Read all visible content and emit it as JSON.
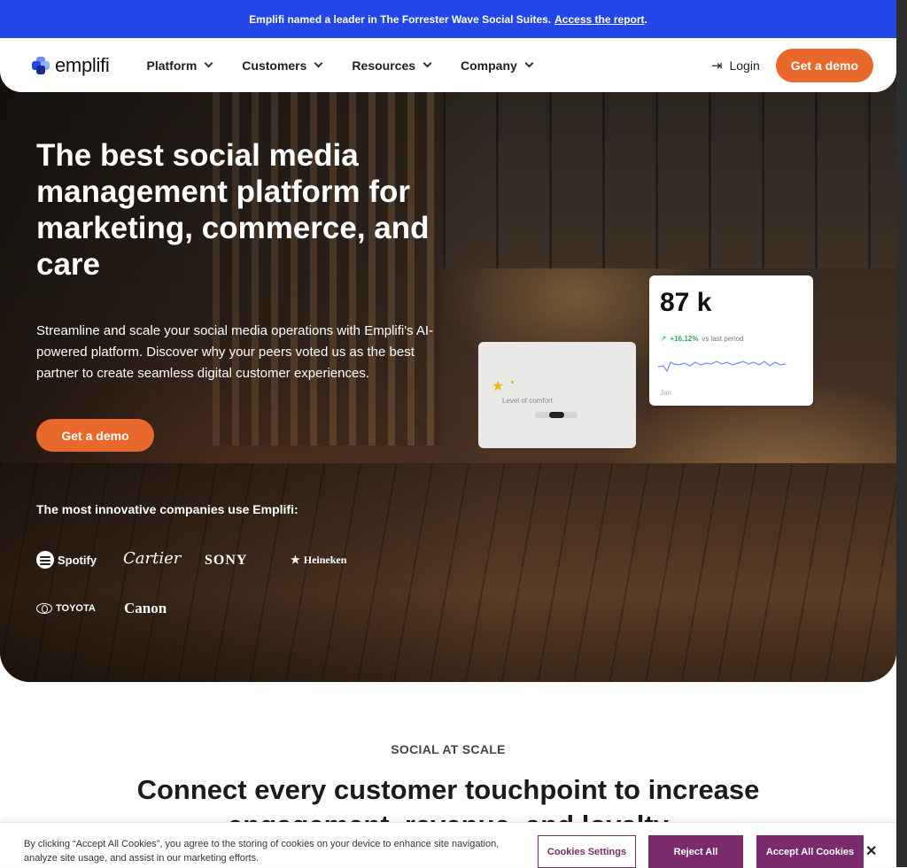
{
  "announcement": {
    "text": "Emplifi named a leader in The Forrester Wave Social Suites.",
    "link": "Access the report",
    "suffix": "."
  },
  "nav": {
    "logo": "emplifi",
    "menu": [
      "Platform",
      "Customers",
      "Resources",
      "Company"
    ],
    "login": "Login",
    "cta": "Get a demo"
  },
  "hero": {
    "title": "The best social media management platform for marketing, commerce, and care",
    "subtitle": "Streamline and scale your social media operations with Emplifi's AI-powered platform. Discover why your peers voted us as the best partner to create seamless digital customer experiences.",
    "cta": "Get a demo",
    "logos_title": "The most innovative companies use Emplifi:",
    "logos": [
      "Spotify",
      "Cartier",
      "SONY",
      "Heineken",
      "TOYOTA",
      "Canon"
    ]
  },
  "comfort_card": {
    "label": "Level of comfort",
    "level": 0.5
  },
  "stat_card": {
    "value": "87 k",
    "change": "+16.12%",
    "change_suffix": "vs last period",
    "axis_label": "Jan"
  },
  "section": {
    "eyebrow": "SOCIAL AT SCALE",
    "title_line1": "Connect every customer touchpoint to increase",
    "title_line2": "engagement, revenue, and loyalty"
  },
  "cookie": {
    "text": "By clicking “Accept All Cookies”, you agree to the storing of cookies on your device to enhance site navigation, analyze site usage, and assist in our marketing efforts.",
    "settings": "Cookies Settings",
    "reject": "Reject All",
    "accept": "Accept All Cookies",
    "close": "✕"
  },
  "colors": {
    "announce_bg": "#2347e6",
    "accent_orange": "#e8692b",
    "cookie_purple": "#7a2a6d",
    "trend_green": "#2fa35b",
    "sparkline_blue": "#6f8df7"
  }
}
